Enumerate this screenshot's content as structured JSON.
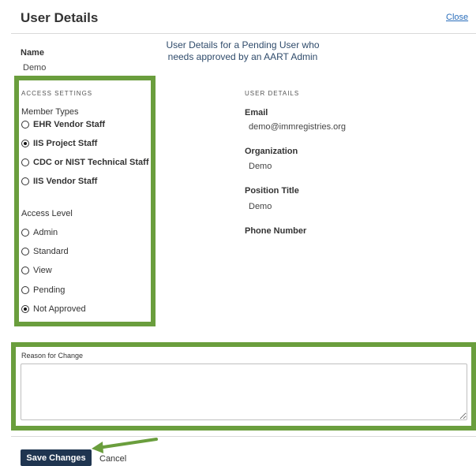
{
  "header": {
    "title": "User Details",
    "close_label": "Close"
  },
  "name": {
    "label": "Name",
    "value": "Demo"
  },
  "annotation": "User Details for a Pending User who needs approved by an AART Admin",
  "access_settings": {
    "heading": "ACCESS SETTINGS",
    "member_types": {
      "label": "Member Types",
      "options": [
        {
          "label": "EHR Vendor Staff",
          "checked": false
        },
        {
          "label": "IIS Project Staff",
          "checked": true
        },
        {
          "label": "CDC or NIST Technical Staff",
          "checked": false
        },
        {
          "label": "IIS Vendor Staff",
          "checked": false
        }
      ]
    },
    "access_level": {
      "label": "Access Level",
      "options": [
        {
          "label": "Admin",
          "checked": false
        },
        {
          "label": "Standard",
          "checked": false
        },
        {
          "label": "View",
          "checked": false
        },
        {
          "label": "Pending",
          "checked": false
        },
        {
          "label": "Not Approved",
          "checked": true
        }
      ]
    }
  },
  "user_details": {
    "heading": "USER DETAILS",
    "email": {
      "label": "Email",
      "value": "demo@immregistries.org"
    },
    "organization": {
      "label": "Organization",
      "value": "Demo"
    },
    "position_title": {
      "label": "Position Title",
      "value": "Demo"
    },
    "phone_number": {
      "label": "Phone Number",
      "value": ""
    }
  },
  "reason": {
    "label": "Reason for Change",
    "value": ""
  },
  "footer": {
    "save_label": "Save Changes",
    "cancel_label": "Cancel"
  },
  "colors": {
    "highlight": "#6a9e3d",
    "button_bg": "#1f3550",
    "link": "#2a6ebb"
  }
}
